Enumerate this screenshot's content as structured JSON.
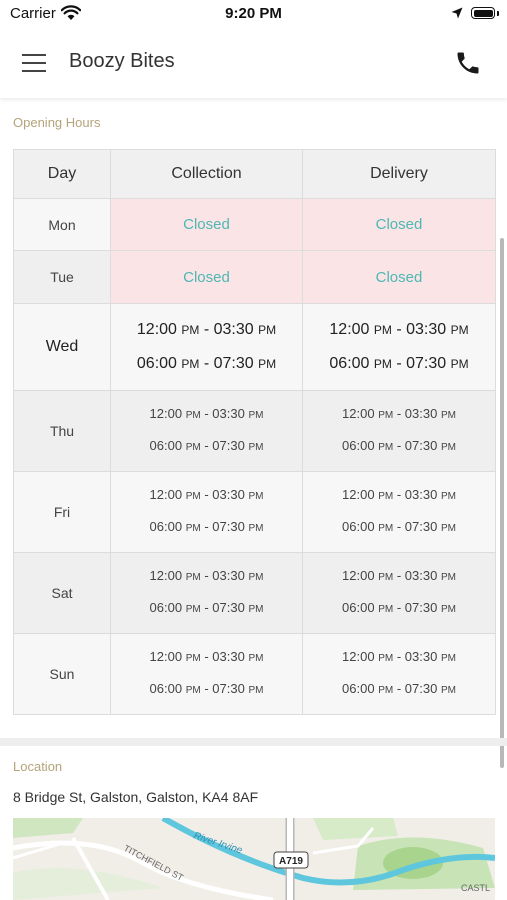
{
  "status_bar": {
    "carrier": "Carrier",
    "time": "9:20 PM"
  },
  "nav": {
    "title": "Boozy Bites"
  },
  "opening_hours": {
    "section_label": "Opening Hours",
    "headers": {
      "day": "Day",
      "collection": "Collection",
      "delivery": "Delivery"
    },
    "closed_text": "Closed",
    "days": [
      {
        "day": "Mon",
        "closed": true
      },
      {
        "day": "Tue",
        "closed": true
      },
      {
        "day": "Wed",
        "today": true,
        "slots": [
          {
            "from": "12:00",
            "from_ampm": "PM",
            "to": "03:30",
            "to_ampm": "PM"
          },
          {
            "from": "06:00",
            "from_ampm": "PM",
            "to": "07:30",
            "to_ampm": "PM"
          }
        ]
      },
      {
        "day": "Thu",
        "slots": [
          {
            "from": "12:00",
            "from_ampm": "PM",
            "to": "03:30",
            "to_ampm": "PM"
          },
          {
            "from": "06:00",
            "from_ampm": "PM",
            "to": "07:30",
            "to_ampm": "PM"
          }
        ]
      },
      {
        "day": "Fri",
        "slots": [
          {
            "from": "12:00",
            "from_ampm": "PM",
            "to": "03:30",
            "to_ampm": "PM"
          },
          {
            "from": "06:00",
            "from_ampm": "PM",
            "to": "07:30",
            "to_ampm": "PM"
          }
        ]
      },
      {
        "day": "Sat",
        "slots": [
          {
            "from": "12:00",
            "from_ampm": "PM",
            "to": "03:30",
            "to_ampm": "PM"
          },
          {
            "from": "06:00",
            "from_ampm": "PM",
            "to": "07:30",
            "to_ampm": "PM"
          }
        ]
      },
      {
        "day": "Sun",
        "slots": [
          {
            "from": "12:00",
            "from_ampm": "PM",
            "to": "03:30",
            "to_ampm": "PM"
          },
          {
            "from": "06:00",
            "from_ampm": "PM",
            "to": "07:30",
            "to_ampm": "PM"
          }
        ]
      }
    ]
  },
  "location": {
    "section_label": "Location",
    "address": "8 Bridge St, Galston, Galston, KA4 8AF",
    "map_labels": {
      "river": "River Irvine",
      "road_badge": "A719",
      "street": "TITCHFIELD ST",
      "edge": "CASTL"
    }
  },
  "colors": {
    "accent_teal": "#4bb8b3",
    "label_gold": "#b5a37b",
    "closed_bg": "#fbe4e6"
  }
}
